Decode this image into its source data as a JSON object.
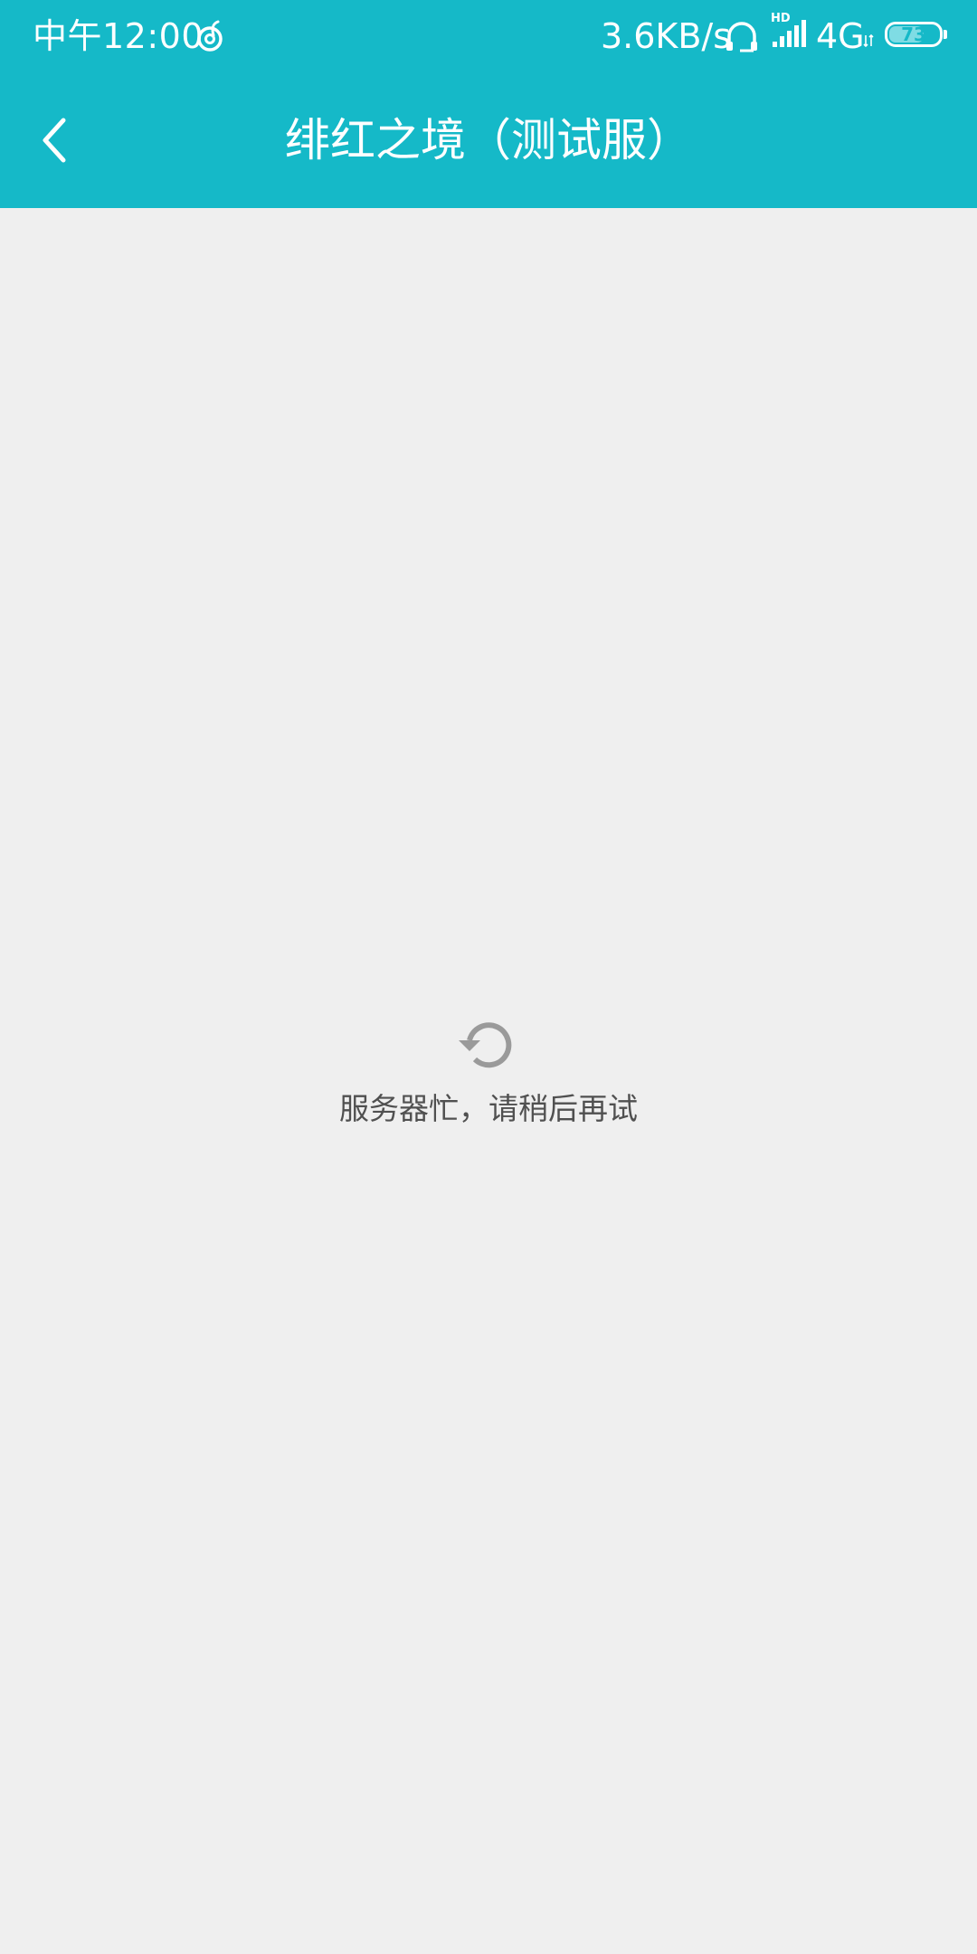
{
  "status_bar": {
    "time": "中午12:00",
    "network_speed": "3.6KB/s",
    "signal_badge": "HD",
    "network_type": "4G",
    "battery_level": "73",
    "battery_fraction": 0.73,
    "icons": [
      "netease-music-icon",
      "headset-icon",
      "signal-icon",
      "data-arrows-icon",
      "battery-icon"
    ]
  },
  "header": {
    "title": "绯红之境（测试服）",
    "back_icon": "chevron-left-icon",
    "background_color": "#15b9c8"
  },
  "content": {
    "background_color": "#efefef",
    "retry_icon": "refresh-icon",
    "error_message": "服务器忙，请稍后再试"
  }
}
